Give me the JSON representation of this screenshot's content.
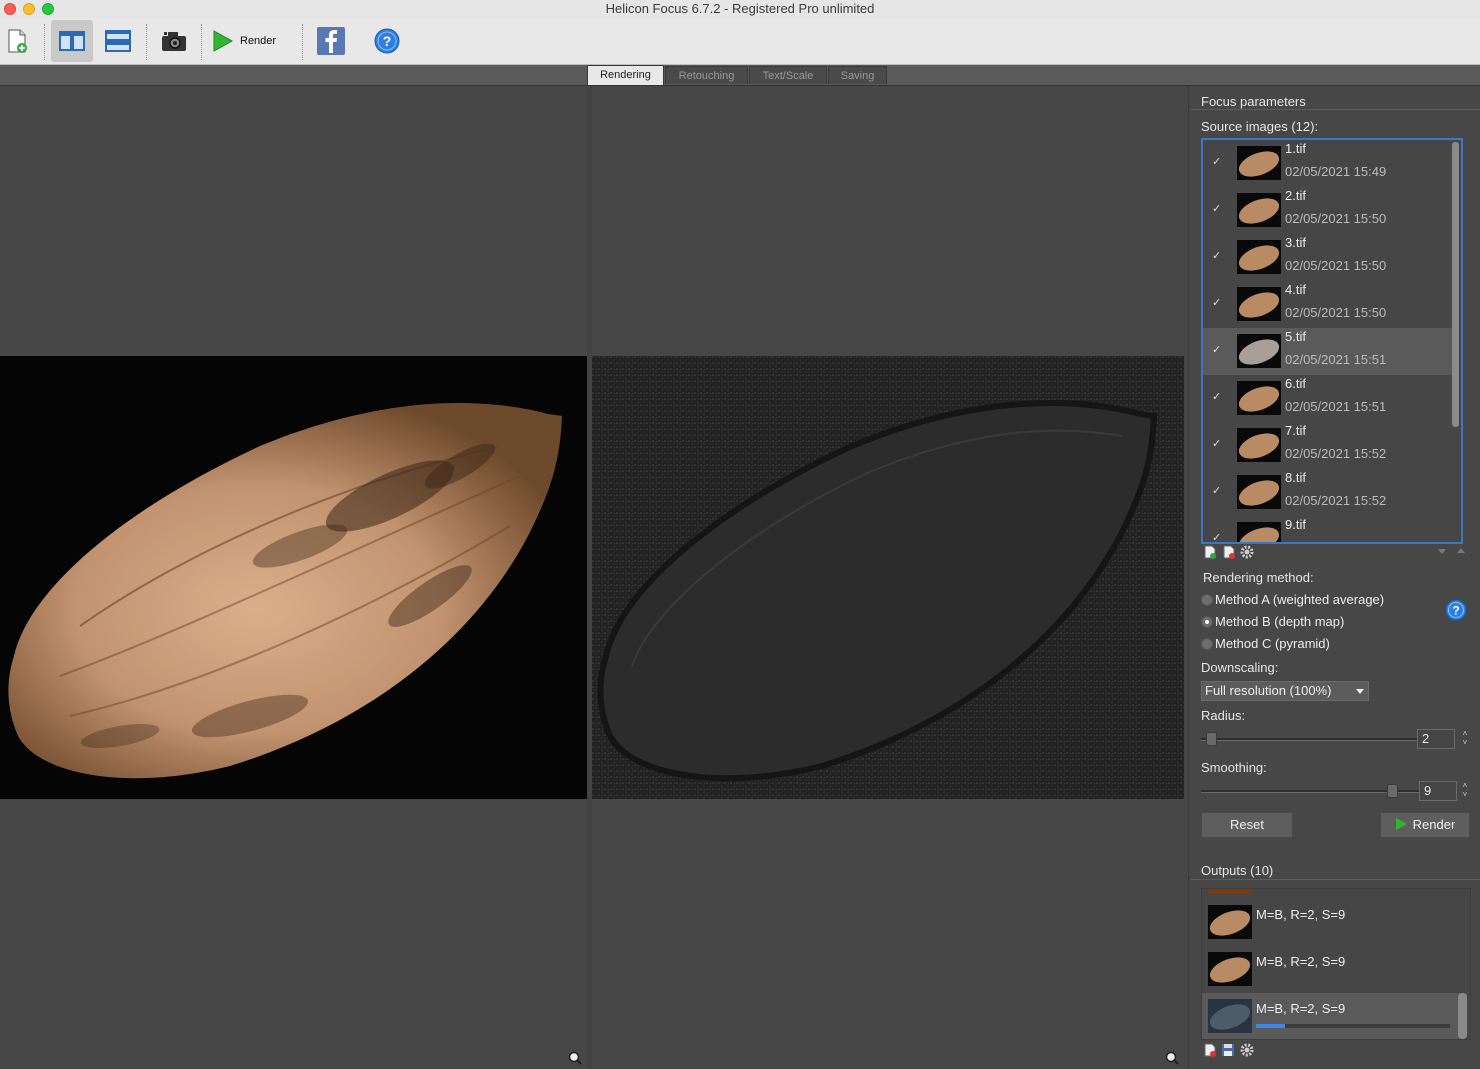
{
  "window": {
    "title": "Helicon Focus 6.7.2 - Registered Pro unlimited"
  },
  "toolbar": {
    "buttons": [
      {
        "name": "new-document-icon"
      },
      {
        "name": "two-pane-view-icon",
        "active": true
      },
      {
        "name": "stacked-view-icon"
      },
      {
        "name": "camera-icon"
      },
      {
        "name": "play-icon",
        "label": "Render"
      },
      {
        "name": "facebook-icon"
      },
      {
        "name": "help-icon"
      }
    ],
    "render_label": "Render"
  },
  "tabs": [
    {
      "label": "Rendering",
      "active": true
    },
    {
      "label": "Retouching"
    },
    {
      "label": "Text/Scale"
    },
    {
      "label": "Saving"
    }
  ],
  "panel": {
    "focus_params_label": "Focus parameters",
    "source_images_label": "Source images (12):",
    "source_images": [
      {
        "name": "1.tif",
        "date": "02/05/2021 15:49",
        "checked": true
      },
      {
        "name": "2.tif",
        "date": "02/05/2021 15:50",
        "checked": true
      },
      {
        "name": "3.tif",
        "date": "02/05/2021 15:50",
        "checked": true
      },
      {
        "name": "4.tif",
        "date": "02/05/2021 15:50",
        "checked": true
      },
      {
        "name": "5.tif",
        "date": "02/05/2021 15:51",
        "checked": true,
        "selected": true
      },
      {
        "name": "6.tif",
        "date": "02/05/2021 15:51",
        "checked": true
      },
      {
        "name": "7.tif",
        "date": "02/05/2021 15:52",
        "checked": true
      },
      {
        "name": "8.tif",
        "date": "02/05/2021 15:52",
        "checked": true
      },
      {
        "name": "9.tif",
        "date": "",
        "checked": true
      }
    ],
    "rendering_method_label": "Rendering method:",
    "methods": [
      {
        "label": "Method A (weighted average)",
        "selected": false
      },
      {
        "label": "Method B (depth map)",
        "selected": true
      },
      {
        "label": "Method C (pyramid)",
        "selected": false
      }
    ],
    "downscaling_label": "Downscaling:",
    "downscaling_value": "Full resolution (100%)",
    "radius_label": "Radius:",
    "radius_value": "2",
    "smoothing_label": "Smoothing:",
    "smoothing_value": "9",
    "reset_label": "Reset",
    "render_label": "Render",
    "outputs_label": "Outputs (10)",
    "outputs": [
      {
        "label": "M=B, R=2, S=9"
      },
      {
        "label": "M=B, R=2, S=9"
      },
      {
        "label": "M=B, R=2, S=9",
        "selected": true,
        "progress": 0.15
      }
    ]
  },
  "colors": {
    "accent": "#3b78c4",
    "render_green": "#33b533",
    "progress": "#3b86e6"
  }
}
